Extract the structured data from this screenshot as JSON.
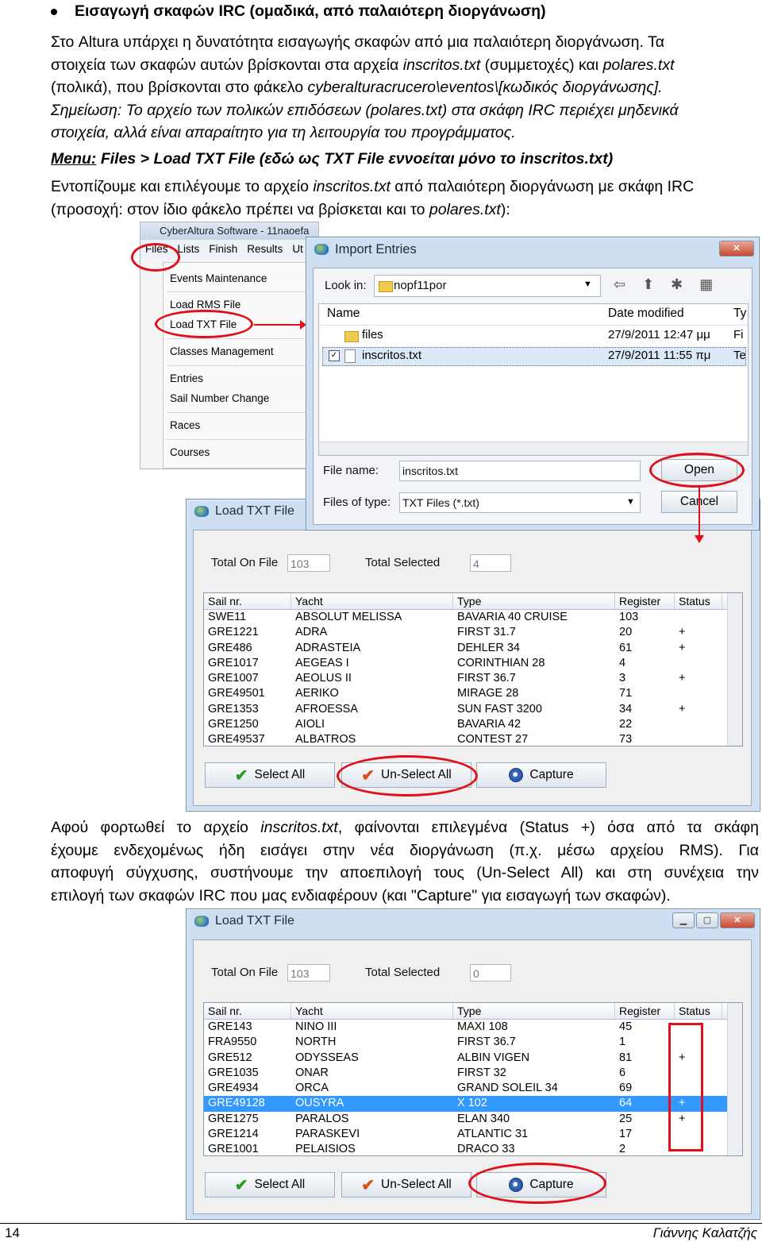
{
  "heading": "Εισαγωγή σκαφών IRC  (ομαδικά, από παλαιότερη διοργάνωση)",
  "intro": {
    "line1": "Στο Altura υπάρχει η δυνατότητα εισαγωγής σκαφών από μια παλαιότερη διοργάνωση. Τα",
    "line2a": "στοιχεία των σκαφών αυτών βρίσκονται στα αρχεία ",
    "line2b": "inscritos.txt",
    "line2c": " (συμμετοχές) και ",
    "line2d": "polares.txt",
    "line3a": "(πολικά), που βρίσκονται στο φάκελο ",
    "line3b": "cyberalturacrucero\\eventos\\[κωδικός διοργάνωσης].",
    "line4": "Σημείωση: Το αρχείο των πολικών επιδόσεων (polares.txt) στα σκάφη IRC περιέχει μηδενικά",
    "line5": "στοιχεία, αλλά είναι απαραίτητο για τη λειτουργία του προγράμματος."
  },
  "menu_line": {
    "label": "Menu:",
    "text": "  Files > Load TXT File   (εδώ ως TXT File εννοείται μόνο το inscritos.txt)"
  },
  "locate": {
    "line1a": "Εντοπίζουμε και επιλέγουμε το αρχείο ",
    "line1b": "inscritos.txt",
    "line1c": " από παλαιότερη διοργάνωση με σκάφη IRC",
    "line2a": "(προσοχή: στον ίδιο φάκελο πρέπει να βρίσκεται και το ",
    "line2b": "polares.txt",
    "line2c": "):"
  },
  "cyber_menu": {
    "title": "CyberAltura Software - 11naoefa",
    "bar": [
      "Files",
      "Lists",
      "Finish",
      "Results",
      "Ut"
    ],
    "items": [
      "Events Maintenance",
      "Load RMS File",
      "Load TXT File",
      "Classes Management",
      "Entries",
      "Sail Number Change",
      "Races",
      "Courses"
    ]
  },
  "import_dialog": {
    "title": "Import Entries",
    "look_in_label": "Look in:",
    "look_in_value": "nopf11por",
    "col_name": "Name",
    "col_date": "Date modified",
    "col_type": "Ty",
    "files": [
      {
        "name": "files",
        "date": "27/9/2011 12:47 μμ",
        "type": "Fi"
      },
      {
        "name": "inscritos.txt",
        "date": "27/9/2011 11:55 πμ",
        "type": "Te"
      }
    ],
    "file_name_label": "File name:",
    "file_name_value": "inscritos.txt",
    "file_type_label": "Files of type:",
    "file_type_value": "TXT Files (*.txt)",
    "open": "Open",
    "cancel": "Cancel"
  },
  "load1": {
    "title": "Load TXT File",
    "total_on_file_label": "Total On File",
    "total_on_file": "103",
    "total_selected_label": "Total Selected",
    "total_selected": "4",
    "headers": [
      "Sail nr.",
      "Yacht",
      "Type",
      "Register",
      "Status"
    ],
    "rows": [
      [
        "SWE11",
        "ABSOLUT MELISSA",
        "BAVARIA 40 CRUISE",
        "103",
        ""
      ],
      [
        "GRE1221",
        "ADRA",
        "FIRST 31.7",
        "20",
        "+"
      ],
      [
        "GRE486",
        "ADRASTEIA",
        "DEHLER 34",
        "61",
        "+"
      ],
      [
        "GRE1017",
        "AEGEAS I",
        "CORINTHIAN 28",
        "4",
        ""
      ],
      [
        "GRE1007",
        "AEOLUS II",
        "FIRST 36.7",
        "3",
        "+"
      ],
      [
        "GRE49501",
        "AERIKO",
        "MIRAGE 28",
        "71",
        ""
      ],
      [
        "GRE1353",
        "AFROESSA",
        "SUN FAST 3200",
        "34",
        "+"
      ],
      [
        "GRE1250",
        "AIOLI",
        "BAVARIA 42",
        "22",
        ""
      ],
      [
        "GRE49537",
        "ALBATROS",
        "CONTEST 27",
        "73",
        ""
      ]
    ],
    "select_all": "Select All",
    "unselect_all": "Un-Select All",
    "capture": "Capture"
  },
  "after": {
    "line1a": "Αφού φορτωθεί το αρχείο ",
    "line1b": "inscritos.txt",
    "line1c": ", φαίνονται επιλεγμένα (Status +) όσα από τα σκάφη",
    "line2": "έχουμε ενδεχομένως ήδη εισάγει στην νέα διοργάνωση (π.χ. μέσω αρχείου RMS). Για",
    "line3": "αποφυγή σύγχυσης, συστήνουμε την αποεπιλογή τους (Un-Select All) και στη συνέχεια την",
    "line4": "επιλογή των σκαφών IRC που μας ενδιαφέρουν (και \"Capture\" για εισαγωγή των σκαφών)."
  },
  "load2": {
    "title": "Load TXT File",
    "total_on_file_label": "Total On File",
    "total_on_file": "103",
    "total_selected_label": "Total Selected",
    "total_selected": "0",
    "headers": [
      "Sail nr.",
      "Yacht",
      "Type",
      "Register",
      "Status"
    ],
    "rows": [
      [
        "GRE143",
        "NINO III",
        "MAXI 108",
        "45",
        ""
      ],
      [
        "FRA9550",
        "NORTH",
        "FIRST 36.7",
        "1",
        ""
      ],
      [
        "GRE512",
        "ODYSSEAS",
        "ALBIN VIGEN",
        "81",
        "+"
      ],
      [
        "GRE1035",
        "ONAR",
        "FIRST 32",
        "6",
        ""
      ],
      [
        "GRE4934",
        "ORCA",
        "GRAND SOLEIL 34",
        "69",
        ""
      ],
      [
        "GRE49128",
        "OUSYRA",
        "X 102",
        "64",
        "+"
      ],
      [
        "GRE1275",
        "PARALOS",
        "ELAN 340",
        "25",
        "+"
      ],
      [
        "GRE1214",
        "PARASKEVI",
        "ATLANTIC 31",
        "17",
        ""
      ],
      [
        "GRE1001",
        "PELAISIOS",
        "DRACO 33",
        "2",
        ""
      ]
    ],
    "selected_row": 5,
    "select_all": "Select All",
    "unselect_all": "Un-Select All",
    "capture": "Capture"
  },
  "footer": {
    "page": "14",
    "author": "Γιάννης Καλατζής"
  },
  "colors": {
    "highlight_red": "#e0101a",
    "selection_blue": "#3399ff"
  }
}
